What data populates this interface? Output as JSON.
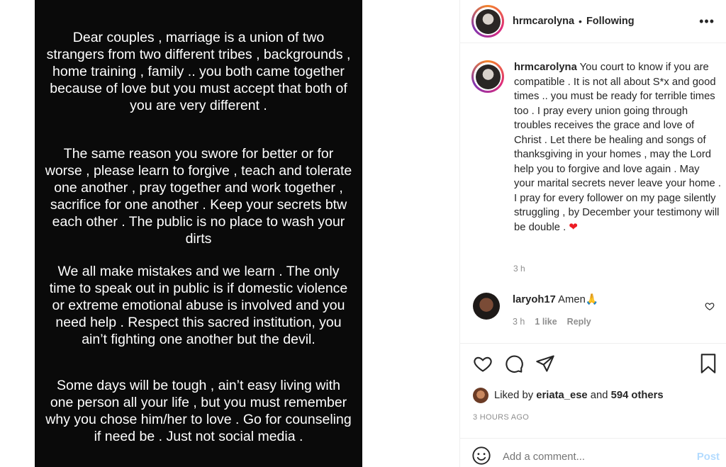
{
  "media": {
    "paragraphs": [
      "Dear couples , marriage is a union of two strangers from two different tribes , backgrounds , home training , family .. you both came together because of love but you must accept that both of you are very different .",
      "The same reason you swore for better or for worse , please learn to forgive , teach and tolerate one another , pray together and work together , sacrifice for one another . Keep your secrets btw each other . The public is no place to wash your dirts",
      "We all make mistakes and we learn . The only time to speak out in public is if domestic violence or extreme emotional abuse is involved and you need help . Respect this sacred institution, you ain’t fighting one another but the devil.",
      "Some days will be tough , ain’t easy living with one person all your life , but you must remember why you chose him/her to love . Go for counseling if need be . Just not social media ."
    ]
  },
  "header": {
    "username": "hrmcarolyna",
    "separator": "•",
    "following": "Following",
    "more_icon": "more-options-icon"
  },
  "caption": {
    "username": "hrmcarolyna",
    "text": "You court to know if you are compatible . It is not all about S*x and good times .. you must be ready for terrible times too . I pray every union going through troubles receives the grace and love of Christ . Let there be healing and songs of thanksgiving in your homes , may the Lord help you to forgive and love again . May your marital secrets never leave your home . I pray for every follower on my page silently struggling , by December your testimony will be double .",
    "emoji": "❤",
    "time": "3 h"
  },
  "comment": {
    "username": "laryoh17",
    "text": "Amen🙏",
    "time": "3 h",
    "likes": "1 like",
    "reply": "Reply"
  },
  "likes": {
    "prefix": "Liked by",
    "user": "eriata_ese",
    "and": "and",
    "others": "594 others"
  },
  "post_time": "3 HOURS AGO",
  "add_comment": {
    "placeholder": "Add a comment...",
    "post_label": "Post"
  },
  "colors": {
    "accent_blue_disabled": "#b3dbff",
    "muted": "#8e8e8e",
    "heart": "#ed1c24"
  }
}
